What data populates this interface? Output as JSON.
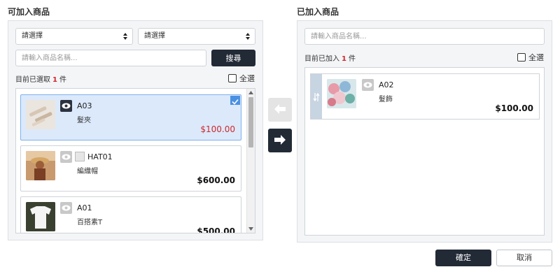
{
  "left": {
    "title": "可加入商品",
    "select1": "請選擇",
    "select2": "請選擇",
    "search_placeholder": "請輸入商品名稱...",
    "search_button": "搜尋",
    "selected_prefix": "目前已選取",
    "selected_count": "1",
    "selected_suffix": "件",
    "check_all": "全選",
    "items": [
      {
        "code": "A03",
        "name": "髮夾",
        "price": "$100.00",
        "selected": true
      },
      {
        "code": "HAT01",
        "name": "編織帽",
        "price": "$600.00",
        "selected": false
      },
      {
        "code": "A01",
        "name": "百搭素T",
        "price": "$500.00",
        "selected": false
      }
    ]
  },
  "right": {
    "title": "已加入商品",
    "search_placeholder": "請輸入商品名稱...",
    "added_prefix": "目前已加入",
    "added_count": "1",
    "added_suffix": "件",
    "check_all": "全選",
    "items": [
      {
        "code": "A02",
        "name": "髮飾",
        "price": "$100.00"
      }
    ]
  },
  "footer": {
    "confirm": "確定",
    "cancel": "取消"
  },
  "colors": {
    "dark": "#222a36",
    "accent_red": "#d0262b",
    "selected_bg": "#dbe9fb",
    "check_blue": "#4a90e2"
  }
}
